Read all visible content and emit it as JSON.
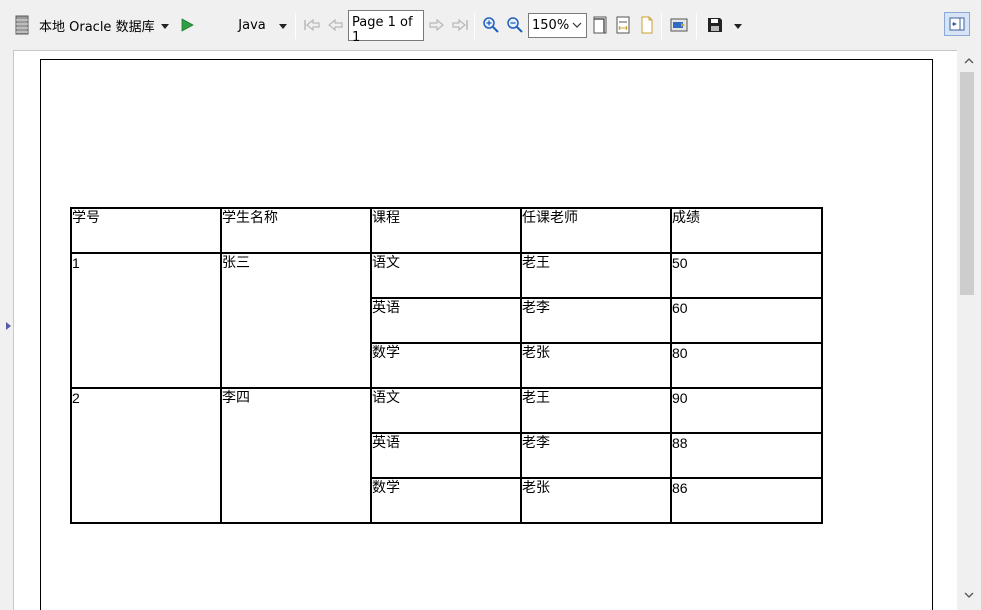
{
  "toolbar": {
    "datasource": "本地 Oracle 数据库",
    "language": "Java",
    "page_indicator": "Page 1 of 1",
    "zoom": "150%"
  },
  "colors": {
    "run_green": "#2ea043",
    "toggle_bg": "#d6e4f5",
    "nav_disabled": "#b8b8b8",
    "zoom_blue": "#1f5fbf"
  },
  "icons": {
    "datasource": "database-icon",
    "run": "play-icon",
    "first": "first-page-icon",
    "prev": "prev-page-icon",
    "next": "next-page-icon",
    "last": "last-page-icon",
    "zoom_in": "zoom-in-icon",
    "zoom_out": "zoom-out-icon",
    "save": "floppy-disk-icon"
  },
  "report": {
    "headers": [
      "学号",
      "学生名称",
      "课程",
      "任课老师",
      "成绩"
    ],
    "groups": [
      {
        "id": "1",
        "name": "张三",
        "rows": [
          {
            "course": "语文",
            "teacher": "老王",
            "score": "50"
          },
          {
            "course": "英语",
            "teacher": "老李",
            "score": "60"
          },
          {
            "course": "数学",
            "teacher": "老张",
            "score": "80"
          }
        ]
      },
      {
        "id": "2",
        "name": "李四",
        "rows": [
          {
            "course": "语文",
            "teacher": "老王",
            "score": "90"
          },
          {
            "course": "英语",
            "teacher": "老李",
            "score": "88"
          },
          {
            "course": "数学",
            "teacher": "老张",
            "score": "86"
          }
        ]
      }
    ]
  }
}
